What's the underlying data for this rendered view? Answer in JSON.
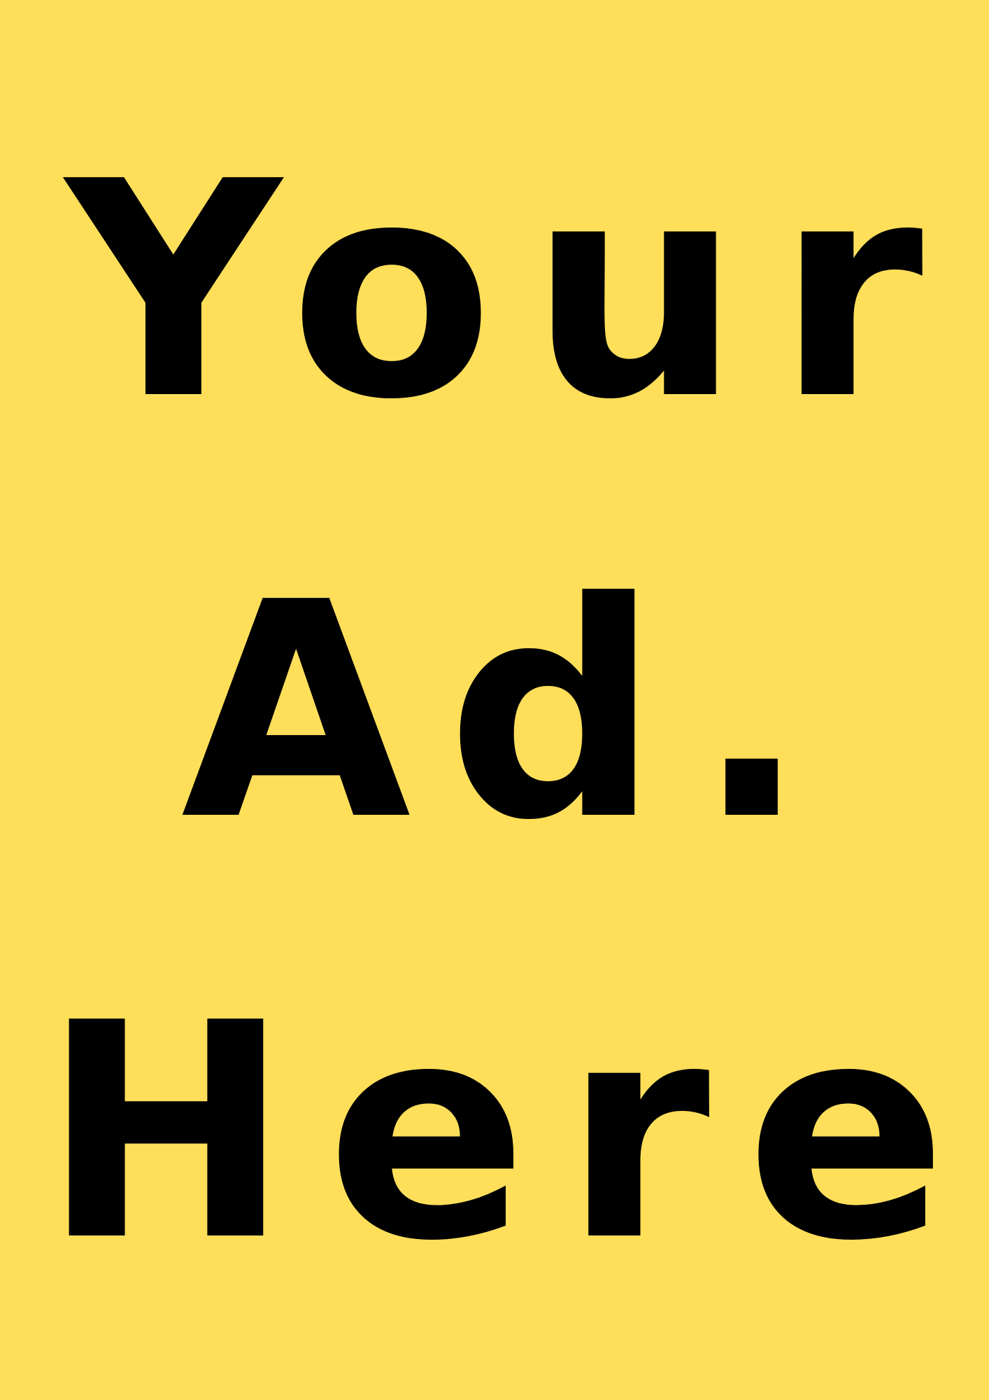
{
  "ad": {
    "lines": [
      "Your",
      "Ad.",
      "Here"
    ],
    "background_color": "#FFDF5A",
    "text_color": "#000000"
  }
}
